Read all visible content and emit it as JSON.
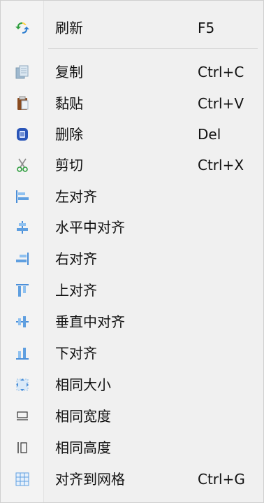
{
  "menu": {
    "items": [
      {
        "label": "刷新",
        "shortcut": "F5",
        "icon": "refresh-icon"
      },
      {
        "label": "复制",
        "shortcut": "Ctrl+C",
        "icon": "copy-icon"
      },
      {
        "label": "黏贴",
        "shortcut": "Ctrl+V",
        "icon": "paste-icon"
      },
      {
        "label": "删除",
        "shortcut": "Del",
        "icon": "delete-icon"
      },
      {
        "label": "剪切",
        "shortcut": "Ctrl+X",
        "icon": "cut-icon"
      },
      {
        "label": "左对齐",
        "shortcut": "",
        "icon": "align-left-icon"
      },
      {
        "label": "水平中对齐",
        "shortcut": "",
        "icon": "align-center-horizontal-icon"
      },
      {
        "label": "右对齐",
        "shortcut": "",
        "icon": "align-right-icon"
      },
      {
        "label": "上对齐",
        "shortcut": "",
        "icon": "align-top-icon"
      },
      {
        "label": "垂直中对齐",
        "shortcut": "",
        "icon": "align-center-vertical-icon"
      },
      {
        "label": "下对齐",
        "shortcut": "",
        "icon": "align-bottom-icon"
      },
      {
        "label": "相同大小",
        "shortcut": "",
        "icon": "same-size-icon"
      },
      {
        "label": "相同宽度",
        "shortcut": "",
        "icon": "same-width-icon"
      },
      {
        "label": "相同高度",
        "shortcut": "",
        "icon": "same-height-icon"
      },
      {
        "label": "对齐到网格",
        "shortcut": "Ctrl+G",
        "icon": "align-to-grid-icon"
      }
    ]
  }
}
